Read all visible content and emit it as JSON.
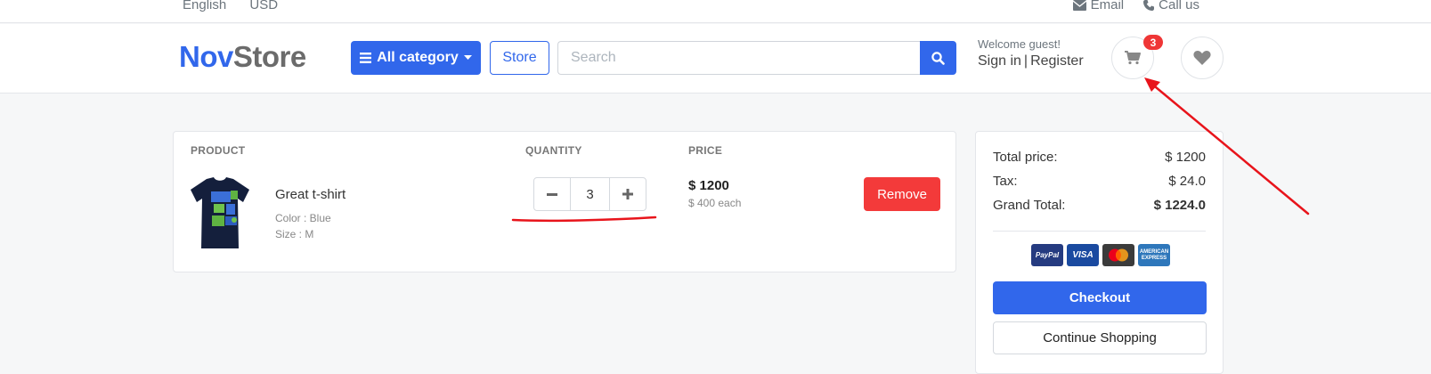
{
  "topbar": {
    "language": "English",
    "currency": "USD",
    "email_label": "Email",
    "call_label": "Call us"
  },
  "header": {
    "logo_part1": "Nov",
    "logo_part2": "Store",
    "category_button": "All category",
    "store_button": "Store",
    "search_placeholder": "Search",
    "search_value": "",
    "welcome_text": "Welcome guest!",
    "sign_in": "Sign in",
    "separator": "|",
    "register": "Register",
    "cart_count": "3"
  },
  "cart": {
    "columns": {
      "product": "PRODUCT",
      "quantity": "QUANTITY",
      "price": "PRICE"
    },
    "items": [
      {
        "name": "Great t-shirt",
        "color": "Color : Blue",
        "size": "Size : M",
        "quantity": "3",
        "total_price": "$ 1200",
        "unit_price": "$ 400 each",
        "remove_label": "Remove"
      }
    ]
  },
  "summary": {
    "total_label": "Total price:",
    "total_value": "$ 1200",
    "tax_label": "Tax:",
    "tax_value": "$ 24.0",
    "grand_label": "Grand Total:",
    "grand_value": "$ 1224.0",
    "payment_methods": {
      "paypal": "PayPal",
      "visa": "VISA",
      "amex": "AMERICAN EXPRESS"
    },
    "checkout_label": "Checkout",
    "continue_label": "Continue Shopping"
  },
  "colors": {
    "primary": "#3167eb",
    "danger": "#f33a3a",
    "annotation": "#e8141b"
  }
}
